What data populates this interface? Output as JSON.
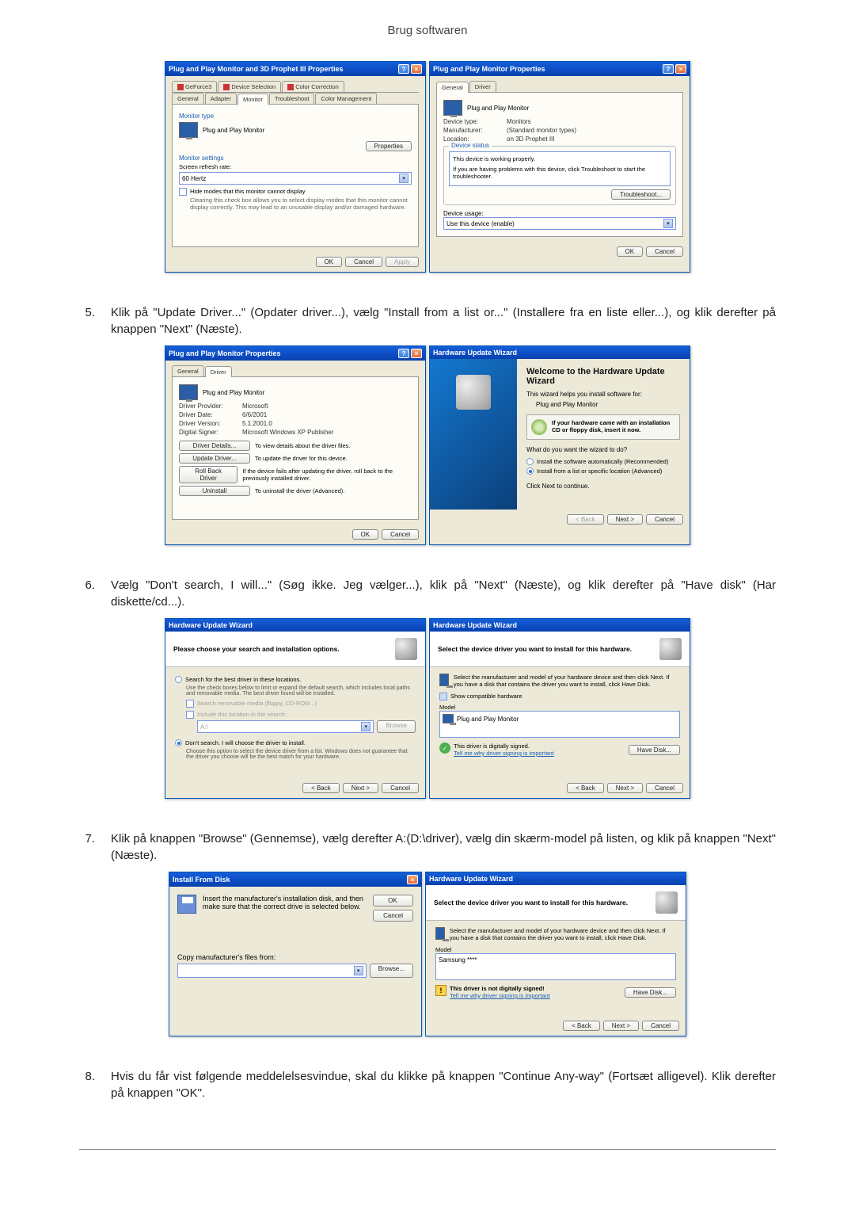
{
  "header": {
    "title": "Brug softwaren"
  },
  "steps": {
    "s5": {
      "num": "5.",
      "text": "Klik på \"Update Driver...\" (Opdater driver...), vælg \"Install from a list or...\" (Installere fra en liste eller...), og klik derefter på knappen \"Next\" (Næste)."
    },
    "s6": {
      "num": "6.",
      "text": "Vælg \"Don't search, I will...\" (Søg ikke. Jeg vælger...), klik på \"Next\" (Næste), og klik derefter på \"Have disk\" (Har diskette/cd...)."
    },
    "s7": {
      "num": "7.",
      "text": "Klik på knappen \"Browse\" (Gennemse), vælg derefter A:(D:\\driver), vælg din skærm-model på listen, og klik på knappen \"Next\" (Næste)."
    },
    "s8": {
      "num": "8.",
      "text": "Hvis du får vist følgende meddelelsesvindue, skal du klikke på knappen \"Continue Any-way\" (Fortsæt alligevel). Klik derefter på knappen \"OK\"."
    }
  },
  "dlg1": {
    "title": "Plug and Play Monitor and 3D Prophet III Properties",
    "tabs": {
      "geforce3": "GeForce3",
      "device_selection": "Device Selection",
      "color_correction": "Color Correction",
      "general": "General",
      "adapter": "Adapter",
      "monitor": "Monitor",
      "troubleshoot": "Troubleshoot",
      "color_mgmt": "Color Management"
    },
    "monitor_type_label": "Monitor type",
    "monitor_name": "Plug and Play Monitor",
    "properties_btn": "Properties",
    "monitor_settings_label": "Monitor settings",
    "refresh_label": "Screen refresh rate:",
    "refresh_value": "60 Hertz",
    "hide_modes_label": "Hide modes that this monitor cannot display",
    "hide_modes_help": "Clearing this check box allows you to select display modes that this monitor cannot display correctly. This may lead to an unusable display and/or damaged hardware.",
    "ok": "OK",
    "cancel": "Cancel",
    "apply": "Apply"
  },
  "dlg2": {
    "title": "Plug and Play Monitor Properties",
    "tabs": {
      "general": "General",
      "driver": "Driver"
    },
    "monitor_name": "Plug and Play Monitor",
    "device_type_l": "Device type:",
    "device_type_v": "Monitors",
    "manufacturer_l": "Manufacturer:",
    "manufacturer_v": "(Standard monitor types)",
    "location_l": "Location:",
    "location_v": "on 3D Prophet III",
    "status_label": "Device status",
    "status_line1": "This device is working properly.",
    "status_line2": "If you are having problems with this device, click Troubleshoot to start the troubleshooter.",
    "troubleshoot_btn": "Troubleshoot...",
    "usage_label": "Device usage:",
    "usage_value": "Use this device (enable)",
    "ok": "OK",
    "cancel": "Cancel"
  },
  "dlg3": {
    "title": "Plug and Play Monitor Properties",
    "tabs": {
      "general": "General",
      "driver": "Driver"
    },
    "monitor_name": "Plug and Play Monitor",
    "provider_l": "Driver Provider:",
    "provider_v": "Microsoft",
    "date_l": "Driver Date:",
    "date_v": "6/6/2001",
    "version_l": "Driver Version:",
    "version_v": "5.1.2001.0",
    "signer_l": "Digital Signer:",
    "signer_v": "Microsoft Windows XP Publisher",
    "details_btn": "Driver Details...",
    "details_txt": "To view details about the driver files.",
    "update_btn": "Update Driver...",
    "update_txt": "To update the driver for this device.",
    "rollback_btn": "Roll Back Driver",
    "rollback_txt": "If the device fails after updating the driver, roll back to the previously installed driver.",
    "uninstall_btn": "Uninstall",
    "uninstall_txt": "To uninstall the driver (Advanced).",
    "ok": "OK",
    "cancel": "Cancel"
  },
  "dlg4": {
    "title": "Hardware Update Wizard",
    "welcome": "Welcome to the Hardware Update Wizard",
    "helps": "This wizard helps you install software for:",
    "device": "Plug and Play Monitor",
    "cd_hint": "If your hardware came with an installation CD or floppy disk, insert it now.",
    "question": "What do you want the wizard to do?",
    "opt1": "Install the software automatically (Recommended)",
    "opt2": "Install from a list or specific location (Advanced)",
    "click_next": "Click Next to continue.",
    "back": "< Back",
    "next": "Next >",
    "cancel": "Cancel"
  },
  "dlg5": {
    "title": "Hardware Update Wizard",
    "header": "Please choose your search and installation options.",
    "opt_search": "Search for the best driver in these locations.",
    "search_help": "Use the check boxes below to limit or expand the default search, which includes local paths and removable media. The best driver found will be installed.",
    "cb1": "Search removable media (floppy, CD-ROM...)",
    "cb2": "Include this location in the search:",
    "path": "A:\\",
    "browse": "Browse",
    "opt_dont": "Don't search. I will choose the driver to install.",
    "dont_help": "Choose this option to select the device driver from a list. Windows does not guarantee that the driver you choose will be the best match for your hardware.",
    "back": "< Back",
    "next": "Next >",
    "cancel": "Cancel"
  },
  "dlg6": {
    "title": "Hardware Update Wizard",
    "header": "Select the device driver you want to install for this hardware.",
    "instruction": "Select the manufacturer and model of your hardware device and then click Next. If you have a disk that contains the driver you want to install, click Have Disk.",
    "show_compat": "Show compatible hardware",
    "model_label": "Model",
    "model_item": "Plug and Play Monitor",
    "signed": "This driver is digitally signed.",
    "tell_me": "Tell me why driver signing is important",
    "have_disk": "Have Disk...",
    "back": "< Back",
    "next": "Next >",
    "cancel": "Cancel"
  },
  "dlg7": {
    "title": "Install From Disk",
    "instruction": "Insert the manufacturer's installation disk, and then make sure that the correct drive is selected below.",
    "copy_from": "Copy manufacturer's files from:",
    "ok": "OK",
    "cancel": "Cancel",
    "browse": "Browse..."
  },
  "dlg8": {
    "title": "Hardware Update Wizard",
    "header": "Select the device driver you want to install for this hardware.",
    "instruction": "Select the manufacturer and model of your hardware device and then click Next. If you have a disk that contains the driver you want to install, click Have Disk.",
    "model_label": "Model",
    "model_item": "Samsung ****",
    "not_signed": "This driver is not digitally signed!",
    "tell_me": "Tell me why driver signing is important",
    "have_disk": "Have Disk...",
    "back": "< Back",
    "next": "Next >",
    "cancel": "Cancel"
  }
}
